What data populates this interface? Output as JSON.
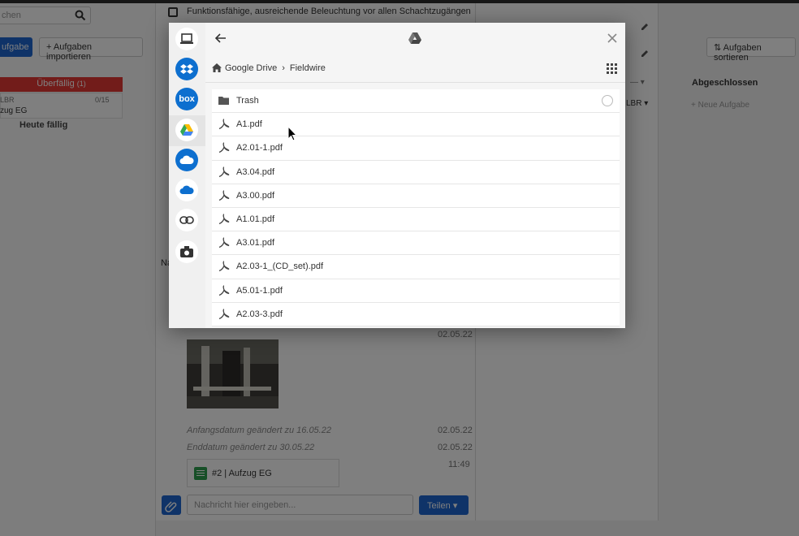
{
  "background": {
    "search_placeholder": "chen",
    "add_task_label": "ufgabe",
    "import_label": "Aufgaben importieren",
    "sort_label": "Aufgaben sortieren",
    "overdue_label": "Überfällig",
    "overdue_count": "(1)",
    "card_ref": "LBR",
    "card_progress": "0/15",
    "card_title": "zug EG",
    "today_label": "Heute fällig",
    "checklist_item": "Funktionsfähige, ausreichende Beleuchtung vor allen Schachtzugängen",
    "done_column": "Abgeschlossen",
    "new_task": "+ Neue Aufgabe",
    "lbr_label": "LBR",
    "na_label": "Na",
    "date_top": "02.05.22",
    "log_start": "Anfangsdatum geändert zu 16.05.22",
    "log_start_date": "02.05.22",
    "log_end": "Enddatum geändert zu 30.05.22",
    "log_end_date": "02.05.22",
    "log_time": "11:49",
    "task_ref": "#2 | Aufzug EG",
    "message_placeholder": "Nachricht hier eingeben...",
    "share_label": "Teilen"
  },
  "picker": {
    "sources": [
      {
        "name": "device",
        "icon": "laptop-icon"
      },
      {
        "name": "dropbox",
        "icon": "dropbox-icon"
      },
      {
        "name": "box",
        "icon": "box-icon",
        "label": "box"
      },
      {
        "name": "google-drive",
        "icon": "google-drive-icon"
      },
      {
        "name": "cloud",
        "icon": "cloud-icon"
      },
      {
        "name": "onedrive",
        "icon": "onedrive-icon"
      },
      {
        "name": "link",
        "icon": "link-icon"
      },
      {
        "name": "camera",
        "icon": "camera-icon"
      }
    ],
    "active_source": "google-drive",
    "breadcrumb": {
      "root": "Google Drive",
      "separator": "›",
      "current": "Fieldwire"
    },
    "files": [
      {
        "name": "Trash",
        "type": "folder"
      },
      {
        "name": "A1.pdf",
        "type": "pdf"
      },
      {
        "name": "A2.01-1.pdf",
        "type": "pdf"
      },
      {
        "name": "A3.04.pdf",
        "type": "pdf"
      },
      {
        "name": "A3.00.pdf",
        "type": "pdf"
      },
      {
        "name": "A1.01.pdf",
        "type": "pdf"
      },
      {
        "name": "A3.01.pdf",
        "type": "pdf"
      },
      {
        "name": "A2.03-1_(CD_set).pdf",
        "type": "pdf"
      },
      {
        "name": "A5.01-1.pdf",
        "type": "pdf"
      },
      {
        "name": "A2.03-3.pdf",
        "type": "pdf"
      }
    ]
  },
  "colors": {
    "accent": "#1e66d0",
    "overdue": "#e53935",
    "dropbox": "#0d6fcf"
  }
}
